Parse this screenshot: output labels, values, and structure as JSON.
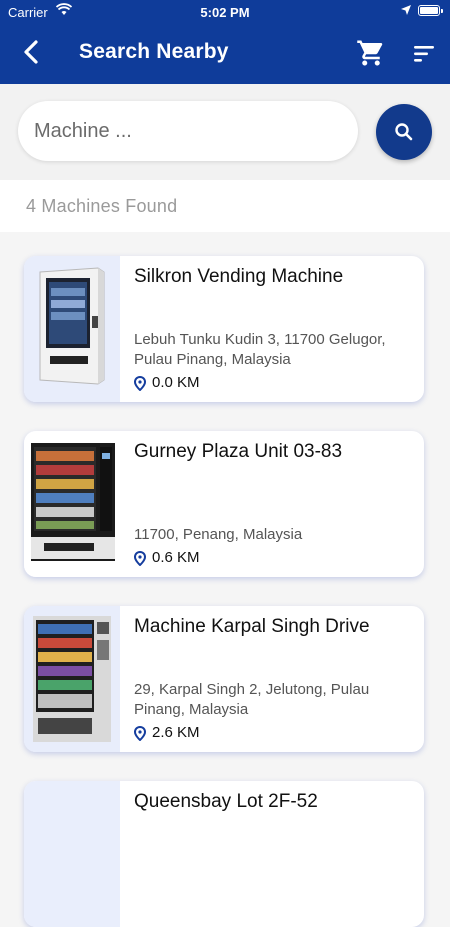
{
  "status": {
    "carrier": "Carrier",
    "time": "5:02 PM"
  },
  "header": {
    "title": "Search Nearby",
    "back_icon": "back-arrow-icon",
    "cart_icon": "cart-icon",
    "filter_icon": "filter-icon"
  },
  "search": {
    "placeholder": "Machine ...",
    "value": "",
    "button_icon": "search-icon"
  },
  "results": {
    "summary": "4 Machines Found"
  },
  "machines": [
    {
      "name": "Silkron Vending Machine",
      "address": "Lebuh Tunku Kudin 3, 11700 Gelugor, Pulau Pinang, Malaysia",
      "distance": "0.0 KM"
    },
    {
      "name": "Gurney Plaza Unit 03-83",
      "address": "11700, Penang, Malaysia",
      "distance": "0.6 KM"
    },
    {
      "name": "Machine Karpal Singh Drive",
      "address": "29, Karpal Singh 2, Jelutong, Pulau Pinang, Malaysia",
      "distance": "2.6 KM"
    },
    {
      "name": "Queensbay Lot 2F-52",
      "address": "",
      "distance": ""
    }
  ],
  "colors": {
    "header": "#0f3c9a",
    "accent": "#123a8c",
    "card_shadow": "#1e3cb4"
  }
}
